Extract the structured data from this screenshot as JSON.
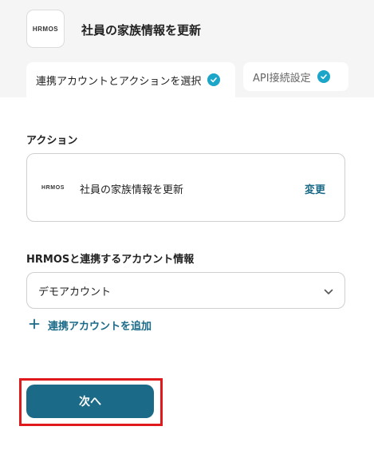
{
  "header": {
    "logo_text": "HRMOS",
    "title": "社員の家族情報を更新"
  },
  "tabs": [
    {
      "label": "連携アカウントとアクションを選択",
      "completed": true
    },
    {
      "label": "API接続設定",
      "completed": true
    }
  ],
  "action_section": {
    "label": "アクション",
    "card_logo_text": "HRMOS",
    "action_name": "社員の家族情報を更新",
    "change_label": "変更"
  },
  "account_section": {
    "label": "HRMOSと連携するアカウント情報",
    "selected_account": "デモアカウント",
    "add_account_label": "連携アカウントを追加"
  },
  "footer": {
    "next_label": "次へ"
  },
  "colors": {
    "accent": "#1a6a88",
    "check": "#1ba6c9",
    "highlight": "#e0191c"
  }
}
